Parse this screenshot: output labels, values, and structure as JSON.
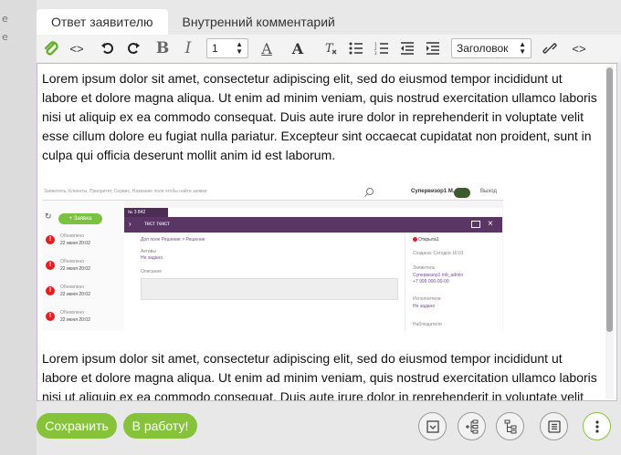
{
  "ghost_left": [
    "е",
    "е"
  ],
  "tabs": [
    {
      "label": "Ответ заявителю"
    },
    {
      "label": "Внутренний комментарий"
    }
  ],
  "toolbar": {
    "font_size": "1",
    "text_a": "A",
    "text_a_bold": "A",
    "heading_select": "Заголовок",
    "italic": "I",
    "bold": "B",
    "code": "<>"
  },
  "editor": {
    "paragraph1": "Lorem ipsum dolor sit amet, consectetur adipiscing elit, sed do eiusmod tempor incididunt ut labore et dolore magna aliqua. Ut enim ad minim veniam, quis nostrud exercitation ullamco laboris nisi ut aliquip ex ea commodo consequat. Duis aute irure dolor in reprehenderit in voluptate velit esse cillum dolore eu fugiat nulla pariatur. Excepteur sint occaecat cupidatat non proident, sunt in culpa qui officia deserunt mollit anim id est laborum.",
    "paragraph2": "Lorem ipsum dolor sit amet, consectetur adipiscing elit, sed do eiusmod tempor incididunt ut labore et dolore magna aliqua. Ut enim ad minim veniam, quis nostrud exercitation ullamco laboris nisi ut aliquip ex ea commodo consequat. Duis aute irure dolor in reprehenderit in voluptate velit"
  },
  "embedded": {
    "search_placeholder": "Заявитель, Клиенты, Приоритет, Сервис, Название поля чтобы найти заявки",
    "user_name": "Супервизор1 М.",
    "exit": "Выход",
    "add_button": "+ Заявка",
    "rows": [
      {
        "label": "Обновлено",
        "date": "22 июня 20:02",
        "icon": "!"
      },
      {
        "label": "Обновлено",
        "date": "22 июня 20:02",
        "icon": "!"
      },
      {
        "label": "Обновлено",
        "date": "22 июня 20:02",
        "icon": "!"
      },
      {
        "label": "Обновлено",
        "date": "22 июня 20:02",
        "icon": "!"
      }
    ],
    "tab_label": "№ 3 842",
    "modal_title": "тест текст",
    "path": "Доп поле Решение > Решение",
    "active_label": "Активы",
    "active_value": "Не задано",
    "description_label": "Описание",
    "status": "Открыта1",
    "created": "Создана: Сегодня 16:01",
    "applicant_label": "Заявитель",
    "applicant": "Супервизор1 mb_admin",
    "phone": "+7 999 000-00-00",
    "executor_label": "Исполнители",
    "executor_value": "Не задано",
    "observers_label": "Наблюдатели"
  },
  "footer": {
    "save": "Сохранить",
    "to_work": "В работу!"
  },
  "colors": {
    "accent_green": "#86c33b",
    "modal_purple": "#5b3566",
    "editor_border": "#c9b3e6"
  }
}
